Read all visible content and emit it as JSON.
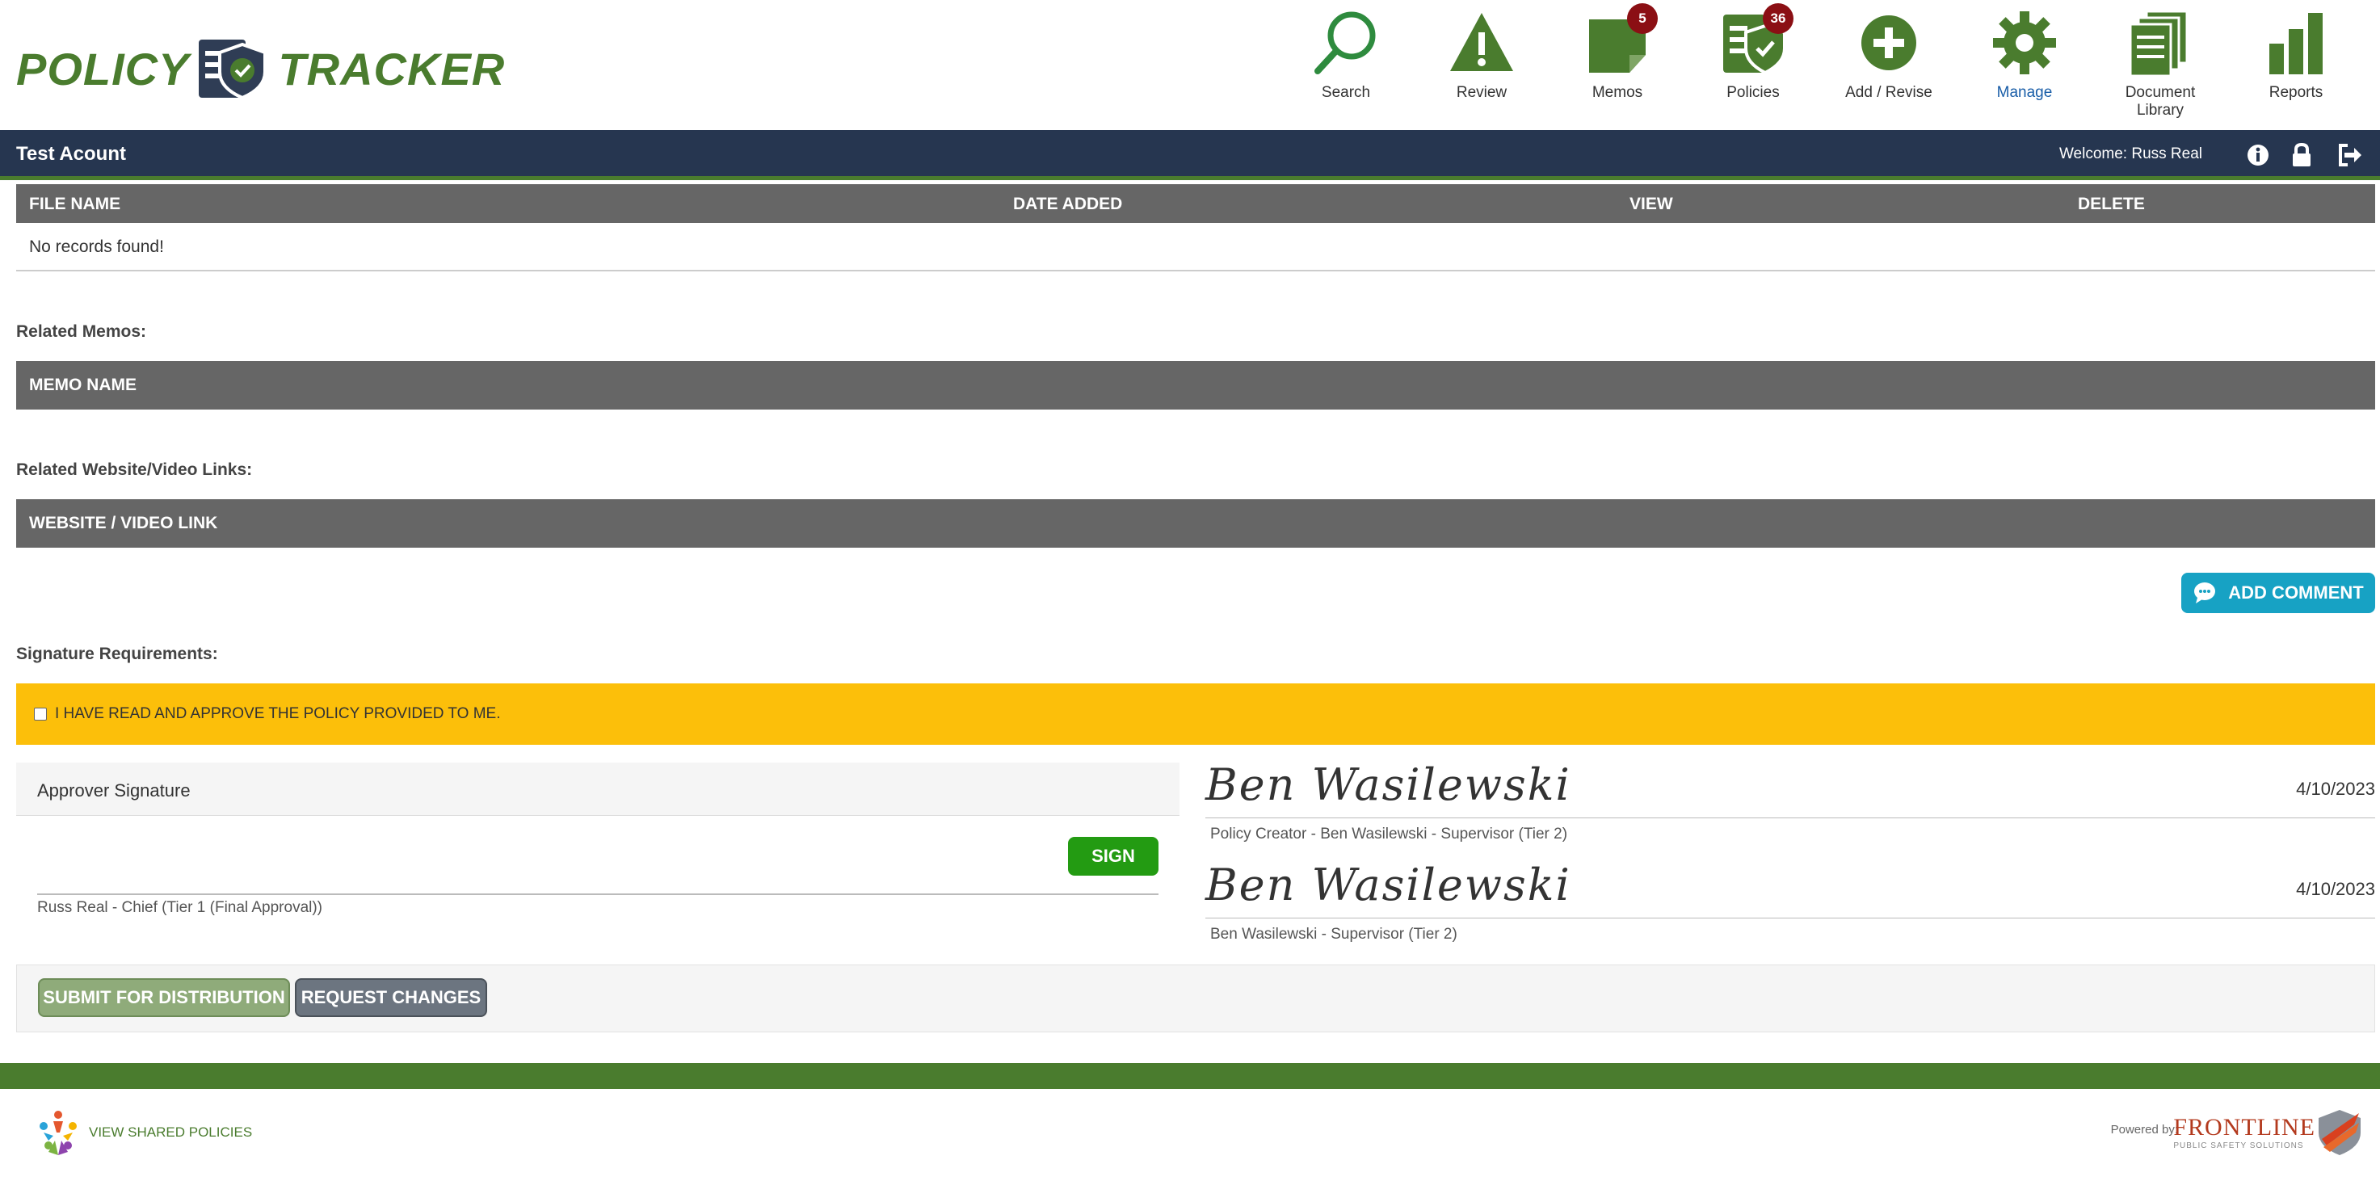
{
  "header": {
    "logo_left": "POLICY",
    "logo_right": "TRACKER",
    "nav": [
      {
        "id": "search",
        "label": "Search",
        "icon": "search-icon"
      },
      {
        "id": "review",
        "label": "Review",
        "icon": "warning-icon"
      },
      {
        "id": "memos",
        "label": "Memos",
        "icon": "memo-icon",
        "badge": "5"
      },
      {
        "id": "policies",
        "label": "Policies",
        "icon": "policy-shield-icon",
        "badge": "36"
      },
      {
        "id": "add",
        "label": "Add / Revise",
        "icon": "plus-circle-icon"
      },
      {
        "id": "manage",
        "label": "Manage",
        "icon": "gear-icon"
      },
      {
        "id": "library",
        "label": "Document Library",
        "icon": "documents-icon"
      },
      {
        "id": "reports",
        "label": "Reports",
        "icon": "bar-chart-icon"
      }
    ]
  },
  "accountbar": {
    "account": "Test Acount",
    "welcome": "Welcome: Russ Real"
  },
  "files_table": {
    "columns": [
      "FILE NAME",
      "DATE ADDED",
      "VIEW",
      "DELETE"
    ],
    "empty": "No records found!"
  },
  "memos": {
    "label": "Related Memos:",
    "column": "MEMO NAME"
  },
  "links": {
    "label": "Related Website/Video Links:",
    "column": "WEBSITE / VIDEO LINK"
  },
  "comment": {
    "label": "ADD COMMENT"
  },
  "signatures": {
    "label": "Signature Requirements:",
    "approve_text": "I HAVE READ AND APPROVE THE POLICY PROVIDED TO ME.",
    "approver_heading": "Approver Signature",
    "sign_label": "SIGN",
    "approver_sub": "Russ Real - Chief (Tier 1 (Final Approval))",
    "signed": [
      {
        "name": "Ben Wasilewski",
        "date": "4/10/2023",
        "caption": "Policy Creator - Ben Wasilewski - Supervisor (Tier 2)"
      },
      {
        "name": "Ben Wasilewski",
        "date": "4/10/2023",
        "caption": "Ben Wasilewski - Supervisor (Tier 2)"
      }
    ]
  },
  "actions": {
    "submit": "SUBMIT FOR DISTRIBUTION",
    "request": "REQUEST CHANGES"
  },
  "footer": {
    "shared": "VIEW SHARED POLICIES",
    "powered": "Powered by:",
    "brand": "FRONTLINE",
    "brand_sub": "PUBLIC SAFETY SOLUTIONS"
  },
  "colors": {
    "brand_green": "#4a7c2e",
    "navy": "#263650",
    "header_gray": "#666666",
    "approve_yellow": "#fcbf0a",
    "comment_blue": "#17a2c4",
    "sign_green": "#239b12",
    "badge_red": "#8b0f14",
    "active_blue": "#1a5ea8"
  }
}
